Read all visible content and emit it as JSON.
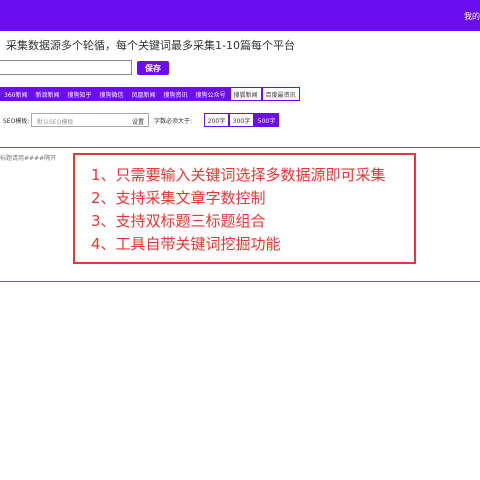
{
  "header": {
    "right_text": "我的",
    "bg_color": "#6a0df0"
  },
  "description": "采集数据源多个轮循，每个关键词最多采集1-10篇每个平台",
  "keyword": {
    "value": "",
    "save_label": "保存"
  },
  "sources": [
    {
      "label": "360新闻",
      "selected": true
    },
    {
      "label": "新浪新闻",
      "selected": true
    },
    {
      "label": "搜狗知乎",
      "selected": true
    },
    {
      "label": "搜狗微信",
      "selected": true
    },
    {
      "label": "凤凰新闻",
      "selected": true
    },
    {
      "label": "搜狗资讯",
      "selected": true
    },
    {
      "label": "搜狗公众号",
      "selected": true
    },
    {
      "label": "搜狐新闻",
      "selected": false
    },
    {
      "label": "百度最资讯",
      "selected": false
    }
  ],
  "seo": {
    "label": "SEO模板:",
    "placeholder": "默认SEO模板",
    "settings_label": "设置"
  },
  "word_count": {
    "label": "字数必须大于:",
    "options": [
      {
        "label": "200字",
        "selected": false
      },
      {
        "label": "300字",
        "selected": false
      },
      {
        "label": "500字",
        "selected": true
      }
    ]
  },
  "title_hint": "标题请用####隔开",
  "callout": {
    "color": "#e53935",
    "lines": [
      "1、只需要输入关键词选择多数据源即可采集",
      "2、支持采集文章字数控制",
      "3、支持双标题三标题组合",
      "4、工具自带关键词挖掘功能"
    ]
  }
}
